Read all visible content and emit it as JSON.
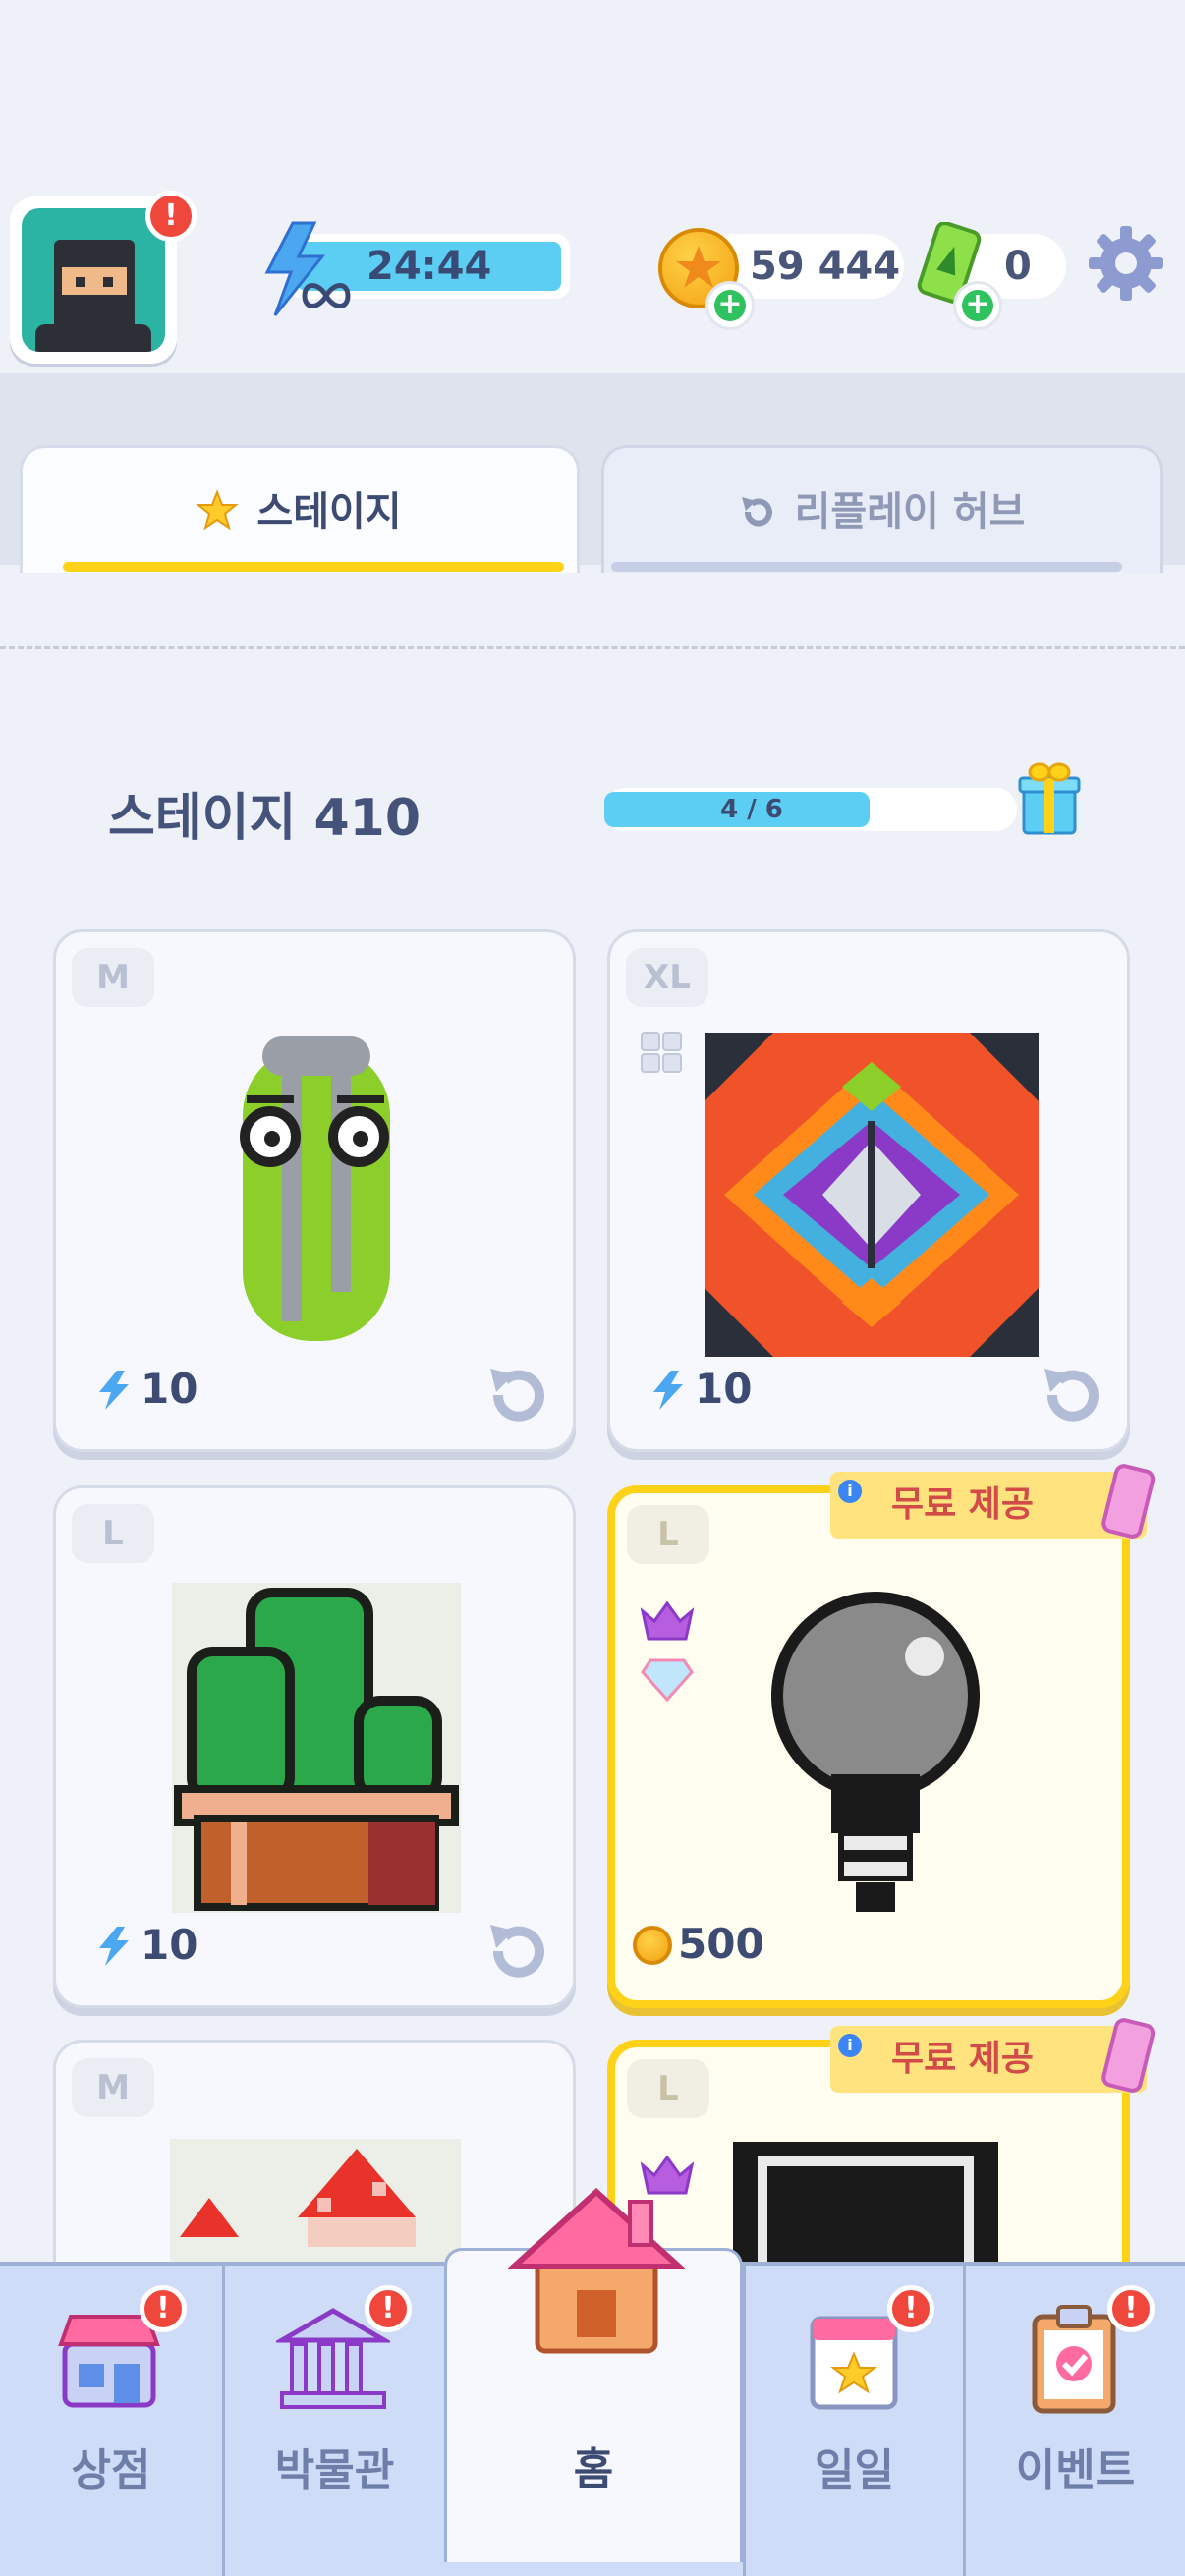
{
  "header": {
    "energy_timer": "24:44",
    "coins": "59 444",
    "tickets": "0"
  },
  "tabs": [
    {
      "label": "스테이지",
      "active": true
    },
    {
      "label": "리플레이 허브",
      "active": false
    }
  ],
  "stage": {
    "title": "스테이지 410",
    "progress_text": "4 / 6",
    "progress_fraction": 0.6667
  },
  "cards": [
    {
      "size": "M",
      "cost": "10",
      "cost_type": "energy",
      "image": "paperclip-pixel-art"
    },
    {
      "size": "XL",
      "cost": "10",
      "cost_type": "energy",
      "image": "mandala-pixel-art"
    },
    {
      "size": "L",
      "cost": "10",
      "cost_type": "energy",
      "image": "cactus-pixel-art"
    },
    {
      "size": "L",
      "cost": "500",
      "cost_type": "coin",
      "image": "lightbulb-pixel-art",
      "banner": "무료 제공"
    },
    {
      "size": "M",
      "image": "mushroom-pixel-art"
    },
    {
      "size": "L",
      "image": "dark-pixel-art",
      "banner": "무료 제공"
    }
  ],
  "nav": [
    {
      "label": "상점",
      "icon": "shop-icon",
      "alert": true
    },
    {
      "label": "박물관",
      "icon": "museum-icon",
      "alert": true
    },
    {
      "label": "홈",
      "icon": "home-icon",
      "alert": false,
      "active": true
    },
    {
      "label": "일일",
      "icon": "daily-calendar-icon",
      "alert": true
    },
    {
      "label": "이벤트",
      "icon": "event-clipboard-icon",
      "alert": true
    }
  ],
  "colors": {
    "accent_blue": "#5ccdf3",
    "premium_yellow": "#ffd21a",
    "alert_red": "#f0473d"
  }
}
